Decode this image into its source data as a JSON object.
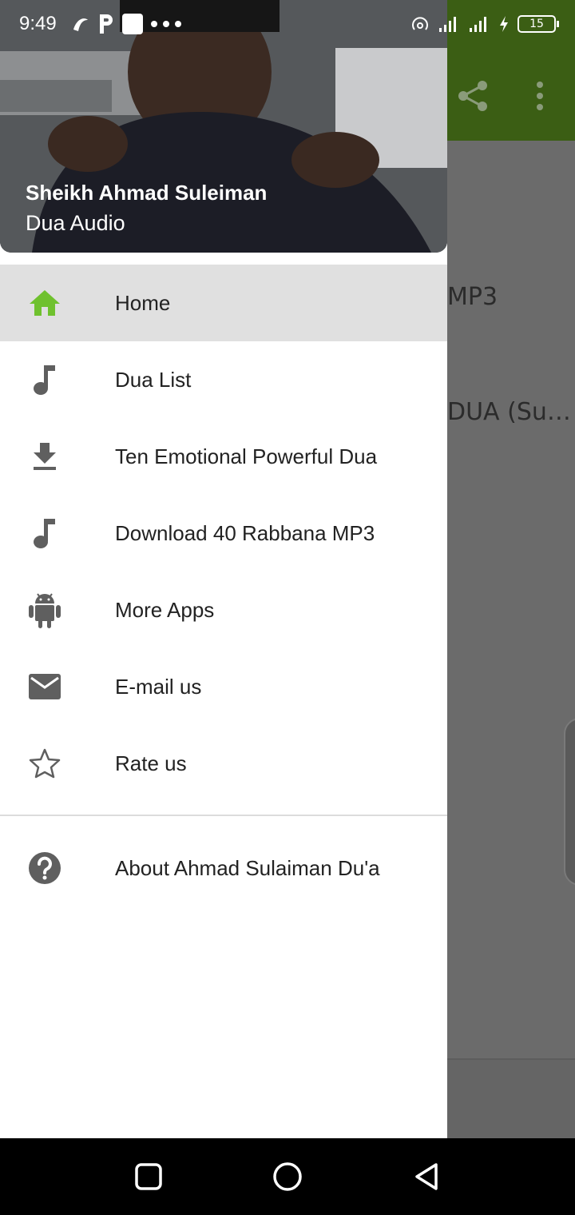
{
  "status_bar": {
    "time": "9:49",
    "battery": "15"
  },
  "drawer": {
    "header": {
      "title": "Sheikh Ahmad Suleiman",
      "subtitle": "Dua Audio"
    },
    "items": [
      {
        "label": "Home",
        "icon": "home-icon",
        "active": true
      },
      {
        "label": "Dua List",
        "icon": "music-note-icon"
      },
      {
        "label": "Ten Emotional Powerful Dua",
        "icon": "download-icon"
      },
      {
        "label": "Download 40 Rabbana MP3",
        "icon": "music-note-icon"
      },
      {
        "label": "More Apps",
        "icon": "android-icon"
      },
      {
        "label": "E-mail us",
        "icon": "mail-icon"
      },
      {
        "label": "Rate us",
        "icon": "star-outline-icon"
      }
    ],
    "footer_item": {
      "label": "About Ahmad Sulaiman Du'a",
      "icon": "help-circle-icon"
    }
  },
  "background": {
    "peek_1": "MP3",
    "peek_2": "DUA (Su…"
  },
  "colors": {
    "accent": "#6fc12e",
    "app_bar": "#3b5e14",
    "scrim_bg": "#6b6b6b"
  }
}
